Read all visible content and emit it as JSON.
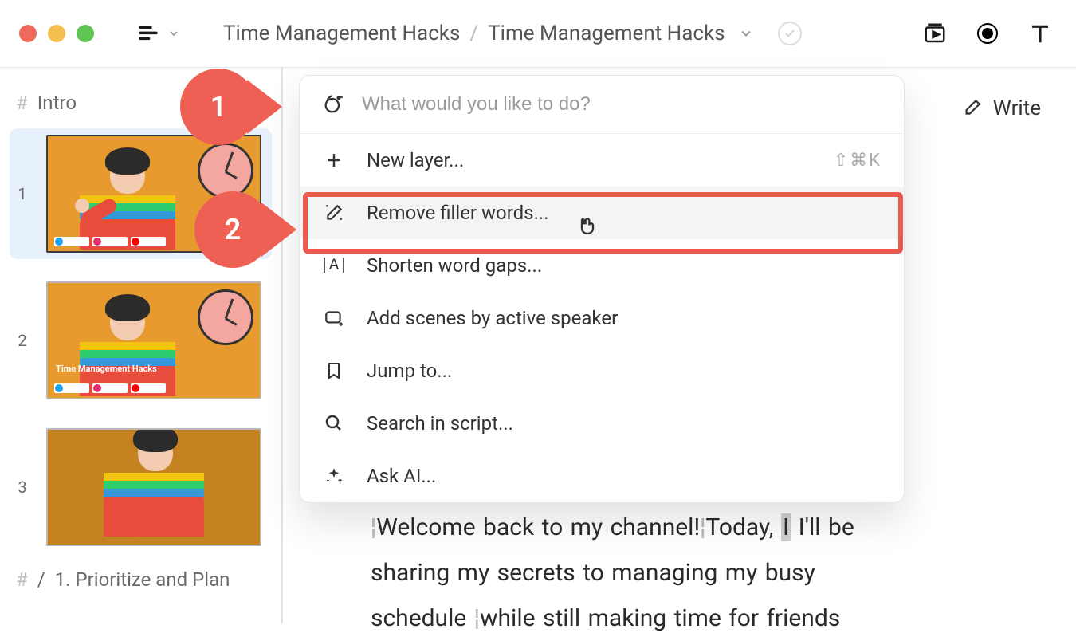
{
  "breadcrumb": {
    "project": "Time Management Hacks",
    "composition": "Time Management Hacks"
  },
  "sidebar": {
    "section_title": "Intro",
    "scenes": [
      {
        "num": "1",
        "overlay": ""
      },
      {
        "num": "2",
        "overlay": "Time Management Hacks"
      },
      {
        "num": "3",
        "overlay": ""
      }
    ],
    "section2_prefix": "/",
    "section2_title": "1. Prioritize and Plan"
  },
  "write_button": "Write",
  "palette": {
    "placeholder": "What would you like to do?",
    "items": [
      {
        "label": "New layer...",
        "shortcut": "⇧⌘K",
        "icon": "plus"
      },
      {
        "label": "Remove filler words...",
        "shortcut": "",
        "icon": "wand-pen"
      },
      {
        "label": "Shorten word gaps...",
        "shortcut": "",
        "icon": "word-gap"
      },
      {
        "label": "Add scenes by active speaker",
        "shortcut": "",
        "icon": "scene-add"
      },
      {
        "label": "Jump to...",
        "shortcut": "",
        "icon": "bookmark"
      },
      {
        "label": "Search in script...",
        "shortcut": "",
        "icon": "search"
      },
      {
        "label": "Ask AI...",
        "shortcut": "",
        "icon": "sparkles"
      }
    ]
  },
  "transcript": {
    "line1_a": "Welcome back to my channel!",
    "line1_b": "Today,",
    "line1_c": "I",
    "line1_d": "I'll be",
    "line2": "sharing my secrets to managing my busy",
    "line3_a": "schedule",
    "line3_b": "while still making time for friends"
  },
  "steps": {
    "one": "1",
    "two": "2"
  }
}
